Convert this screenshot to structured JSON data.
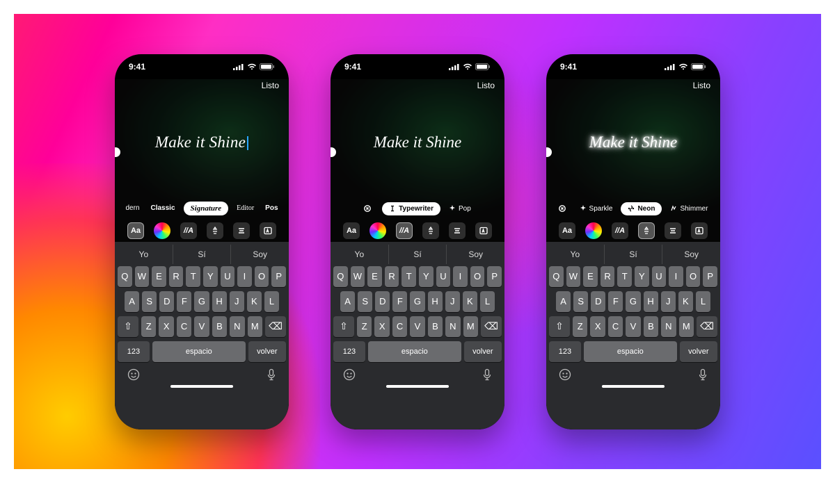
{
  "status_time": "9:41",
  "done_label": "Listo",
  "story_text": "Make it Shine",
  "phones": [
    {
      "style_class": "style-signature",
      "show_cursor": true,
      "chips": [
        {
          "label": "dern",
          "cls": "ghost font-modern",
          "active": false,
          "icon": null
        },
        {
          "label": "Classic",
          "cls": "ghost font-classic",
          "active": false,
          "icon": null
        },
        {
          "label": "Signature",
          "cls": "font-signature",
          "active": true,
          "icon": null
        },
        {
          "label": "Editor",
          "cls": "ghost font-editor",
          "active": false,
          "icon": null
        },
        {
          "label": "Pos",
          "cls": "ghost font-poster",
          "active": false,
          "icon": null
        }
      ],
      "tool_sel_index": 0
    },
    {
      "style_class": "style-typewriter",
      "show_cursor": false,
      "chips": [
        {
          "label": "",
          "cls": "ghost",
          "active": false,
          "icon": "close"
        },
        {
          "label": "Typewriter",
          "cls": "",
          "active": true,
          "icon": "cursor"
        },
        {
          "label": "Pop",
          "cls": "ghost",
          "active": false,
          "icon": "sparkle"
        }
      ],
      "tool_sel_index": 2
    },
    {
      "style_class": "style-neon",
      "show_cursor": false,
      "chips": [
        {
          "label": "",
          "cls": "ghost",
          "active": false,
          "icon": "close"
        },
        {
          "label": "Sparkle",
          "cls": "ghost",
          "active": false,
          "icon": "sparkle"
        },
        {
          "label": "Neon",
          "cls": "",
          "active": true,
          "icon": "neon"
        },
        {
          "label": "Shimmer",
          "cls": "ghost",
          "active": false,
          "icon": "shimmer"
        }
      ],
      "tool_sel_index": 3
    }
  ],
  "tools": {
    "font_size": "Aa",
    "slant": "//A"
  },
  "suggestions": [
    "Yo",
    "Sí",
    "Soy"
  ],
  "keys": {
    "row1": [
      "Q",
      "W",
      "E",
      "R",
      "T",
      "Y",
      "U",
      "I",
      "O",
      "P"
    ],
    "row2": [
      "A",
      "S",
      "D",
      "F",
      "G",
      "H",
      "J",
      "K",
      "L"
    ],
    "row3": [
      "Z",
      "X",
      "C",
      "V",
      "B",
      "N",
      "M"
    ],
    "shift": "⇧",
    "backspace": "⌫",
    "numbers": "123",
    "space": "espacio",
    "return": "volver"
  }
}
